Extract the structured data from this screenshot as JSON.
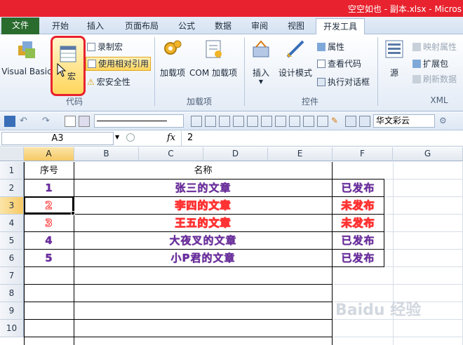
{
  "window": {
    "title": "空空如也 - 副本.xlsx - Micros"
  },
  "tabs": [
    {
      "label": "文件"
    },
    {
      "label": "开始"
    },
    {
      "label": "插入"
    },
    {
      "label": "页面布局"
    },
    {
      "label": "公式"
    },
    {
      "label": "数据"
    },
    {
      "label": "审阅"
    },
    {
      "label": "视图"
    },
    {
      "label": "开发工具"
    }
  ],
  "ribbon": {
    "visual_basic": "Visual Basic",
    "macros": "宏",
    "record_macro": "录制宏",
    "relative_ref": "使用相对引用",
    "macro_security": "宏安全性",
    "group_code": "代码",
    "addins": "加载项",
    "com_addins": "COM 加载项",
    "group_addins": "加载项",
    "insert": "插入",
    "design_mode": "设计模式",
    "properties": "属性",
    "view_code": "查看代码",
    "run_dialog": "执行对话框",
    "group_controls": "控件",
    "source": "源",
    "map_props": "映射属性",
    "expansion": "扩展包",
    "refresh_data": "刷新数据",
    "group_xml": "XML"
  },
  "qat": {
    "font": "华文彩云"
  },
  "formula": {
    "namebox": "A3",
    "fx": "fx",
    "value": "2"
  },
  "columns": [
    "A",
    "B",
    "C",
    "D",
    "E",
    "F",
    "G"
  ],
  "rows": [
    "1",
    "2",
    "3",
    "4",
    "5",
    "6",
    "7",
    "8",
    "9",
    "10"
  ],
  "table": {
    "header_no": "序号",
    "header_name": "名称",
    "rows": [
      {
        "no": "1",
        "name": "张三的文章",
        "status": "已发布",
        "style": "purple"
      },
      {
        "no": "2",
        "name": "李四的文章",
        "status": "未发布",
        "style": "red"
      },
      {
        "no": "3",
        "name": "王五的文章",
        "status": "未发布",
        "style": "red"
      },
      {
        "no": "4",
        "name": "大夜叉的文章",
        "status": "已发布",
        "style": "purple"
      },
      {
        "no": "5",
        "name": "小P君的文章",
        "status": "已发布",
        "style": "purple"
      }
    ]
  },
  "watermark": "Baidu 经验",
  "colors": {
    "title_red": "#e8222e",
    "file_green": "#2a6b2e",
    "purple_text": "#6a2aa0",
    "red_text": "#ff3333"
  }
}
